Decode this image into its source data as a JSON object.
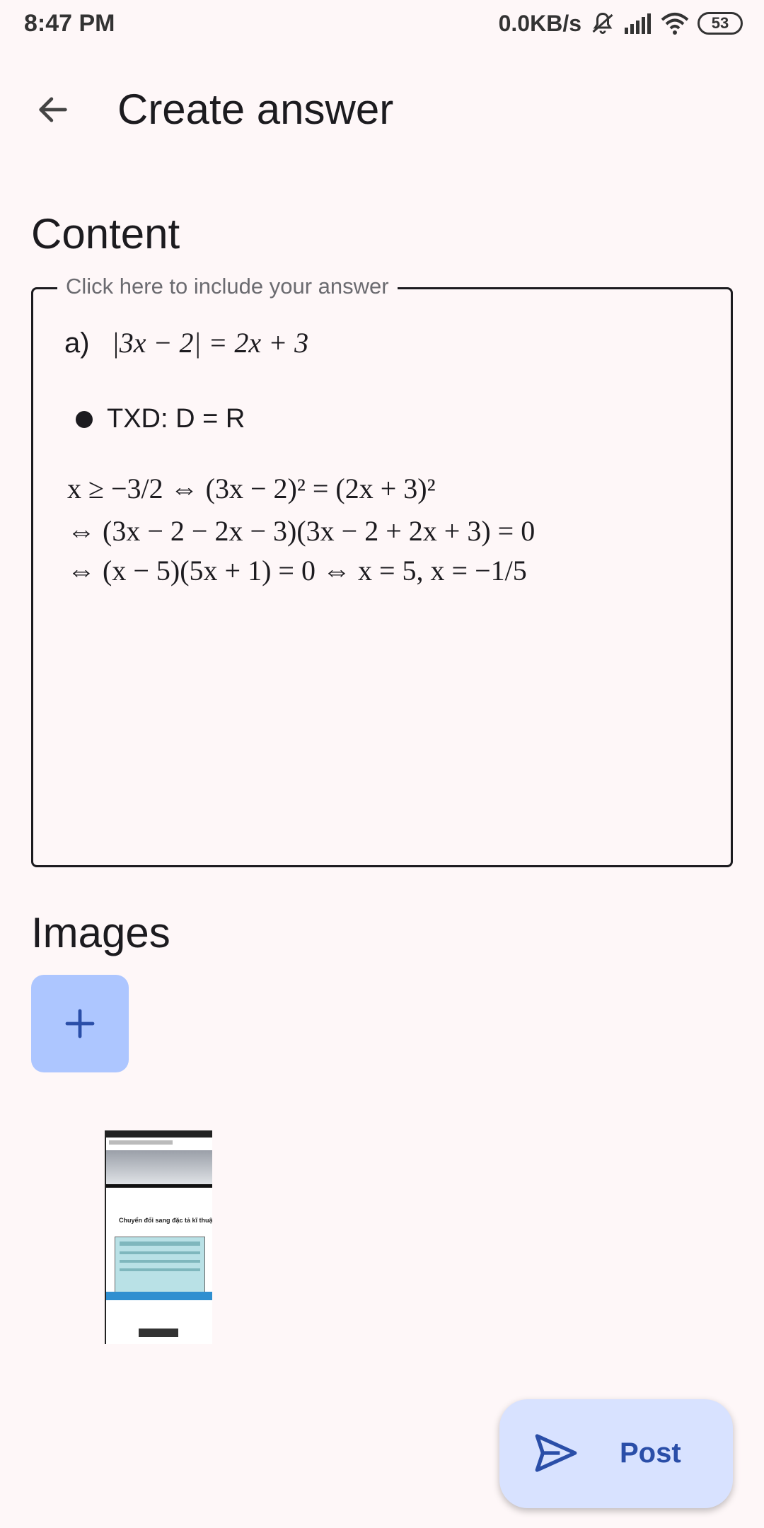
{
  "status_bar": {
    "time": "8:47 PM",
    "net_speed": "0.0KB/s",
    "battery": "53",
    "icons": [
      "muted-bell-icon",
      "signal-icon",
      "wifi-icon",
      "battery-icon"
    ]
  },
  "app_bar": {
    "title": "Create answer",
    "back_icon": "back-arrow-icon"
  },
  "content_section": {
    "title": "Content",
    "field_label": "Click here to include your answer",
    "answer": {
      "part_label": "a)",
      "equation": "|3x − 2| = 2x + 3",
      "bullet": "TXD: D = R",
      "line1": "x ≥ −3/2  ⇔ (3x − 2)² = (2x + 3)²",
      "line2": "⇔ (3x − 2 − 2x − 3)(3x − 2 + 2x + 3) = 0",
      "line3": "⇔ (x − 5)(5x + 1) = 0  ⇔ x = 5, x = −1/5"
    }
  },
  "images_section": {
    "title": "Images",
    "add_icon": "plus-icon",
    "thumbnail_caption": "Chuyển đổi sang đặc tả kĩ thuật"
  },
  "fab": {
    "label": "Post",
    "icon": "send-icon"
  },
  "colors": {
    "background": "#fef7f8",
    "add_button": "#adc6ff",
    "fab_background": "#d8e2ff",
    "accent": "#2a4ea8"
  }
}
